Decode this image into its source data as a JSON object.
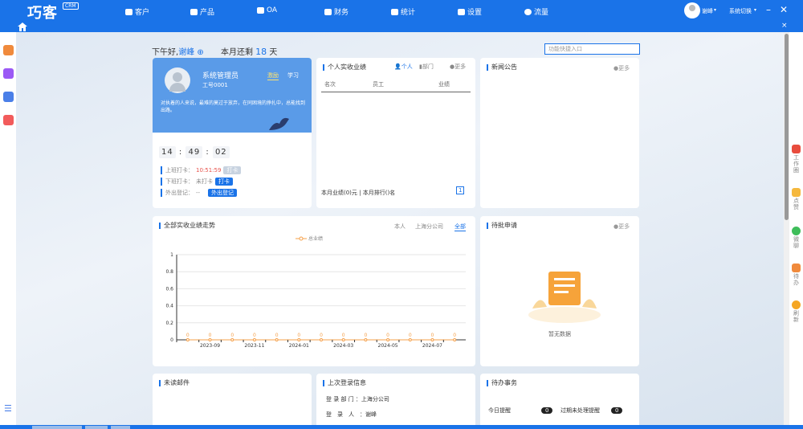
{
  "app": {
    "logo": "巧客",
    "badge": "CRM",
    "user": "谢峰",
    "switch_label": "系统切换"
  },
  "nav": [
    {
      "label": "客户"
    },
    {
      "label": "产品"
    },
    {
      "label": "OA"
    },
    {
      "label": "财务"
    },
    {
      "label": "统计"
    },
    {
      "label": "设置"
    },
    {
      "label": "流量"
    }
  ],
  "greeting": {
    "prefix": "下午好,",
    "name": "谢峰",
    "month_text": "本月还剩",
    "days": "18",
    "days_unit": "天"
  },
  "quick_entry": {
    "placeholder": "功能快捷入口"
  },
  "profile": {
    "title": "系统管理员",
    "employee_no": "工号0001",
    "tab_incentive": "激励",
    "tab_learn": "学习",
    "quote": "对执着的人来说，最难的莫过于放弃，在同困境的挣扎中，总能找到出路。",
    "clock": {
      "h": "14",
      "m": "49",
      "s": "02"
    },
    "checkin_label": "上班打卡：",
    "checkin_time": "10:51:59",
    "checkin_btn": "打卡",
    "checkout_label": "下班打卡：",
    "checkout_status": "未打卡",
    "checkout_btn": "打卡",
    "out_label": "外出登记：",
    "out_value": "--",
    "out_btn": "外出登记"
  },
  "personal_perf": {
    "title": "个人实收业绩",
    "tab_person": "个人",
    "tab_dept": "部门",
    "more": "更多",
    "col_rank": "名次",
    "col_employee": "员工",
    "col_perf": "业绩",
    "footer": "本月业绩(0)元 | 本月排行()名",
    "page": "1"
  },
  "news": {
    "title": "新闻公告",
    "more": "更多"
  },
  "trend": {
    "title": "全部实收业绩走势",
    "filters": [
      "本人",
      "上海分公司",
      "全部"
    ],
    "active_filter": "全部",
    "legend": "总业绩"
  },
  "approval": {
    "title": "待批申请",
    "more": "更多",
    "empty": "暂无数据"
  },
  "mail": {
    "title": "未读邮件"
  },
  "last_login": {
    "title": "上次登录信息",
    "dept_label": "登 录 部 门 ：",
    "dept": "上海分公司",
    "person_label": "登　录　人　：",
    "person": "谢峰"
  },
  "todo": {
    "title": "待办事务",
    "today_label": "今日提醒",
    "today_count": "0",
    "overdue_label": "过期未处理提醒",
    "overdue_count": "0"
  },
  "right_rail": [
    "工作圈",
    "点赞",
    "微聊",
    "待办",
    "刷新"
  ],
  "chart_data": {
    "type": "line",
    "x": [
      "2023-08",
      "2023-09",
      "2023-10",
      "2023-11",
      "2023-12",
      "2024-01",
      "2024-02",
      "2024-03",
      "2024-04",
      "2024-05",
      "2024-06",
      "2024-07",
      "2024-08"
    ],
    "xtick_labels": [
      "2023-09",
      "2023-11",
      "2024-01",
      "2024-03",
      "2024-05",
      "2024-07"
    ],
    "series": [
      {
        "name": "总业绩",
        "values": [
          0,
          0,
          0,
          0,
          0,
          0,
          0,
          0,
          0,
          0,
          0,
          0,
          0
        ],
        "color": "#f5a04a"
      }
    ],
    "ylim": [
      0,
      1
    ],
    "yticks": [
      "0",
      "0.2",
      "0.4",
      "0.6",
      "0.8",
      "1"
    ],
    "grid": true,
    "legend": "top-center"
  }
}
